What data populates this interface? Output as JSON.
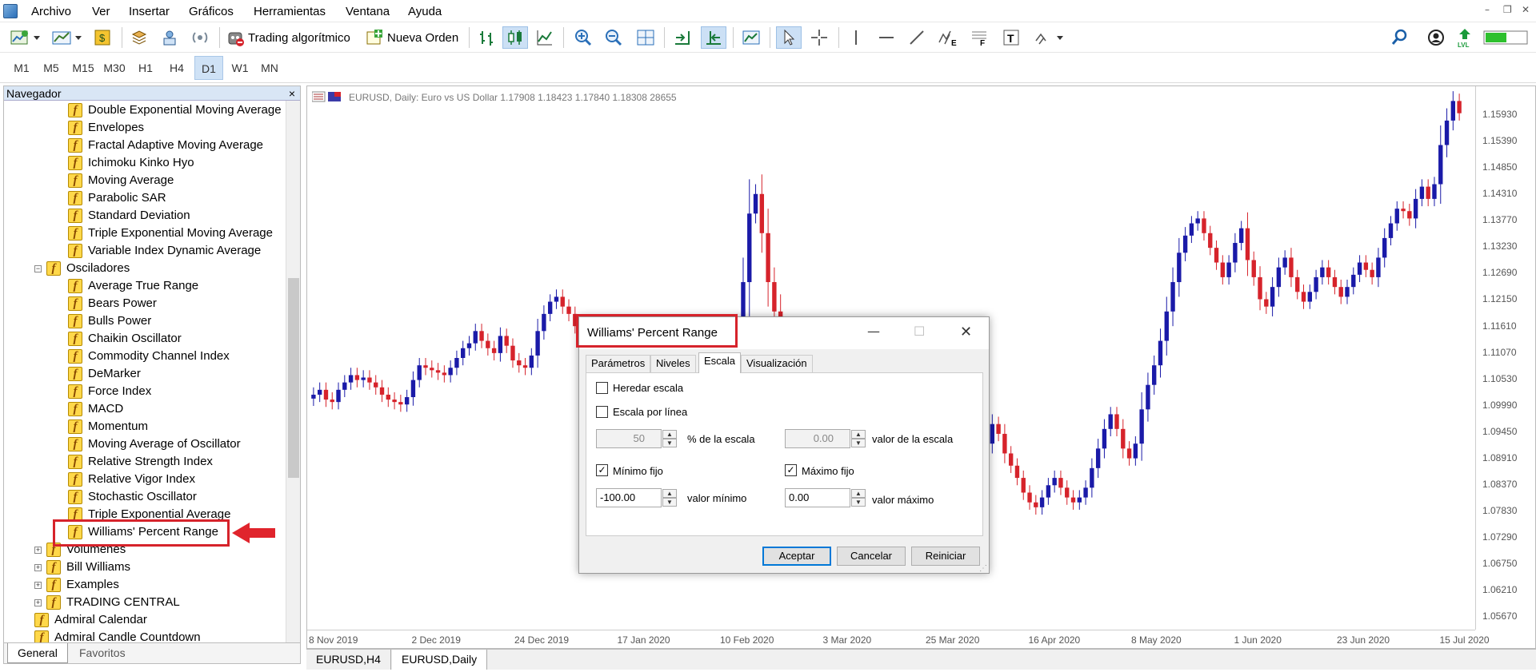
{
  "menu": [
    "Archivo",
    "Ver",
    "Insertar",
    "Gráficos",
    "Herramientas",
    "Ventana",
    "Ayuda"
  ],
  "toolbar": {
    "algo_label": "Trading algorítmico",
    "order_label": "Nueva Orden",
    "lvl_label": "LVL"
  },
  "timeframes": [
    "M1",
    "M5",
    "M15",
    "M30",
    "H1",
    "H4",
    "D1",
    "W1",
    "MN"
  ],
  "active_timeframe": "D1",
  "navigator": {
    "title": "Navegador",
    "close": "×",
    "rows": [
      {
        "label": "Double Exponential Moving Average",
        "type": "f",
        "indent": 2
      },
      {
        "label": "Envelopes",
        "type": "f",
        "indent": 2
      },
      {
        "label": "Fractal Adaptive Moving Average",
        "type": "f",
        "indent": 2
      },
      {
        "label": "Ichimoku Kinko Hyo",
        "type": "f",
        "indent": 2
      },
      {
        "label": "Moving Average",
        "type": "f",
        "indent": 2
      },
      {
        "label": "Parabolic SAR",
        "type": "f",
        "indent": 2
      },
      {
        "label": "Standard Deviation",
        "type": "f",
        "indent": 2
      },
      {
        "label": "Triple Exponential Moving Average",
        "type": "f",
        "indent": 2
      },
      {
        "label": "Variable Index Dynamic Average",
        "type": "f",
        "indent": 2
      },
      {
        "label": "Osciladores",
        "type": "folder",
        "indent": 1,
        "expanded": true
      },
      {
        "label": "Average True Range",
        "type": "f",
        "indent": 2
      },
      {
        "label": "Bears Power",
        "type": "f",
        "indent": 2
      },
      {
        "label": "Bulls Power",
        "type": "f",
        "indent": 2
      },
      {
        "label": "Chaikin Oscillator",
        "type": "f",
        "indent": 2
      },
      {
        "label": "Commodity Channel Index",
        "type": "f",
        "indent": 2
      },
      {
        "label": "DeMarker",
        "type": "f",
        "indent": 2
      },
      {
        "label": "Force Index",
        "type": "f",
        "indent": 2
      },
      {
        "label": "MACD",
        "type": "f",
        "indent": 2
      },
      {
        "label": "Momentum",
        "type": "f",
        "indent": 2
      },
      {
        "label": "Moving Average of Oscillator",
        "type": "f",
        "indent": 2
      },
      {
        "label": "Relative Strength Index",
        "type": "f",
        "indent": 2
      },
      {
        "label": "Relative Vigor Index",
        "type": "f",
        "indent": 2
      },
      {
        "label": "Stochastic Oscillator",
        "type": "f",
        "indent": 2
      },
      {
        "label": "Triple Exponential Average",
        "type": "f",
        "indent": 2
      },
      {
        "label": "Williams' Percent Range",
        "type": "f",
        "indent": 2,
        "highlighted": true
      },
      {
        "label": "Volumenes",
        "type": "folder",
        "indent": 1,
        "expanded": false
      },
      {
        "label": "Bill Williams",
        "type": "folder",
        "indent": 1,
        "expanded": false
      },
      {
        "label": "Examples",
        "type": "folder",
        "indent": 1,
        "expanded": false
      },
      {
        "label": "TRADING CENTRAL",
        "type": "folder",
        "indent": 1,
        "expanded": false
      },
      {
        "label": "Admiral Calendar",
        "type": "f",
        "indent": 1
      },
      {
        "label": "Admiral Candle Countdown",
        "type": "f",
        "indent": 1
      }
    ],
    "tabs": [
      "General",
      "Favoritos"
    ]
  },
  "chart": {
    "info": "EURUSD, Daily:  Euro vs US Dollar  1.17908 1.18423 1.17840 1.18308  28655",
    "price_labels": [
      "1.15930",
      "1.15390",
      "1.14850",
      "1.14310",
      "1.13770",
      "1.13230",
      "1.12690",
      "1.12150",
      "1.11610",
      "1.11070",
      "1.10530",
      "1.09990",
      "1.09450",
      "1.08910",
      "1.08370",
      "1.07830",
      "1.07290",
      "1.06750",
      "1.06210",
      "1.05670"
    ],
    "time_labels": [
      "8 Nov 2019",
      "2 Dec 2019",
      "24 Dec 2019",
      "17 Jan 2020",
      "10 Feb 2020",
      "3 Mar 2020",
      "25 Mar 2020",
      "16 Apr 2020",
      "8 May 2020",
      "1 Jun 2020",
      "23 Jun 2020",
      "15 Jul 2020"
    ],
    "up_color": "#1a1aa8",
    "down_color": "#d6232b",
    "tabs": [
      "EURUSD,H4",
      "EURUSD,Daily"
    ],
    "active_tab": "EURUSD,Daily"
  },
  "chart_data": {
    "type": "candlestick",
    "symbol": "EURUSD",
    "period": "Daily",
    "ylim": [
      1.054,
      1.165
    ],
    "close": [
      1.102,
      1.103,
      1.101,
      1.1005,
      1.103,
      1.1045,
      1.106,
      1.105,
      1.1055,
      1.1045,
      1.1035,
      1.102,
      1.101,
      1.1005,
      1.1,
      1.1015,
      1.105,
      1.108,
      1.1075,
      1.107,
      1.1065,
      1.106,
      1.1075,
      1.1095,
      1.1115,
      1.1125,
      1.115,
      1.113,
      1.1115,
      1.1105,
      1.114,
      1.112,
      1.109,
      1.108,
      1.1075,
      1.11,
      1.115,
      1.1185,
      1.121,
      1.122,
      1.12,
      1.1185,
      1.116,
      1.1135,
      1.1115,
      1.1095,
      1.1075,
      1.106,
      1.1045,
      1.103,
      1.101,
      1.1,
      1.099,
      1.098,
      1.0965,
      1.095,
      1.0935,
      1.0905,
      1.0875,
      1.085,
      1.084,
      1.083,
      1.0855,
      1.089,
      1.0925,
      1.0965,
      1.1015,
      1.108,
      1.115,
      1.125,
      1.139,
      1.143,
      1.135,
      1.125,
      1.119,
      1.112,
      1.107,
      1.102,
      1.095,
      1.09,
      1.088,
      1.085,
      1.083,
      1.084,
      1.087,
      1.09,
      1.093,
      1.095,
      1.0945,
      1.092,
      1.0895,
      1.088,
      1.087,
      1.085,
      1.0855,
      1.087,
      1.09,
      1.093,
      1.094,
      1.091,
      1.089,
      1.087,
      1.0845,
      1.082,
      1.08,
      1.0815,
      1.083,
      1.087,
      1.092,
      1.096,
      1.094,
      1.09,
      1.0875,
      1.085,
      1.082,
      1.08,
      1.079,
      1.081,
      1.0835,
      1.085,
      1.083,
      1.081,
      1.08,
      1.081,
      1.083,
      1.087,
      1.091,
      1.095,
      1.098,
      1.095,
      1.091,
      1.089,
      1.092,
      1.099,
      1.104,
      1.108,
      1.113,
      1.119,
      1.125,
      1.131,
      1.1345,
      1.137,
      1.138,
      1.135,
      1.132,
      1.129,
      1.126,
      1.129,
      1.133,
      1.136,
      1.1295,
      1.126,
      1.1215,
      1.12,
      1.124,
      1.128,
      1.13,
      1.126,
      1.123,
      1.121,
      1.123,
      1.126,
      1.128,
      1.126,
      1.124,
      1.122,
      1.124,
      1.1265,
      1.129,
      1.1275,
      1.126,
      1.13,
      1.134,
      1.137,
      1.14,
      1.1395,
      1.138,
      1.142,
      1.1445,
      1.142,
      1.145,
      1.153,
      1.158,
      1.162,
      1.1595
    ]
  },
  "dialog": {
    "title": "Williams' Percent Range",
    "tabs": [
      "Parámetros",
      "Niveles",
      "Escala",
      "Visualización"
    ],
    "active_tab": "Escala",
    "inherit_scale": "Heredar escala",
    "scale_per_line": "Escala por línea",
    "percent_value": "50",
    "percent_label": "% de la escala",
    "scale_value": "0.00",
    "scale_label": "valor de la escala",
    "min_fixed": "Mínimo fijo",
    "max_fixed": "Máximo fijo",
    "min_value": "-100.00",
    "min_label": "valor mínimo",
    "max_value": "0.00",
    "max_label": "valor máximo",
    "ok": "Aceptar",
    "cancel": "Cancelar",
    "reset": "Reiniciar",
    "check": "✓",
    "min_checked": true,
    "max_checked": true,
    "inherit_checked": false,
    "perline_checked": false
  }
}
